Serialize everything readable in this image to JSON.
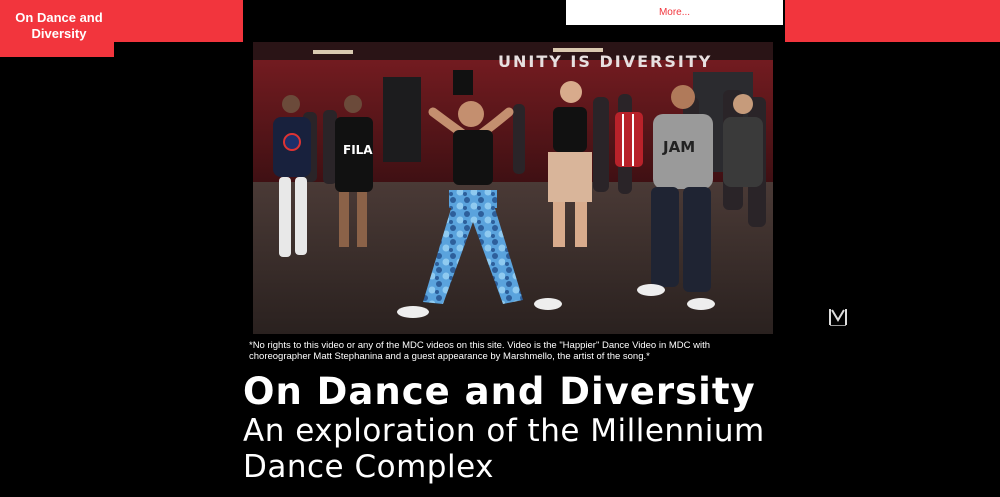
{
  "site": {
    "logo_text": "On Dance and Diversity"
  },
  "nav": {
    "more_label": "More..."
  },
  "video": {
    "banner_text": "UNITY IS DIVERSITY",
    "shirt_text_fila": "FILA",
    "shirt_text_jam": "JAM"
  },
  "caption": "*No rights to this video or any of the MDC videos on this site. Video is the \"Happier\" Dance Video in MDC with choreographer Matt Stephanina and a guest appearance by Marshmello, the artist of the song.*",
  "main": {
    "title": "On Dance and Diversity",
    "subtitle": "An exploration of the Millennium Dance Complex"
  },
  "colors": {
    "accent": "#f2353d",
    "background": "#000000",
    "text": "#ffffff"
  },
  "icons": {
    "side_logo": "millennium-logo-icon"
  }
}
